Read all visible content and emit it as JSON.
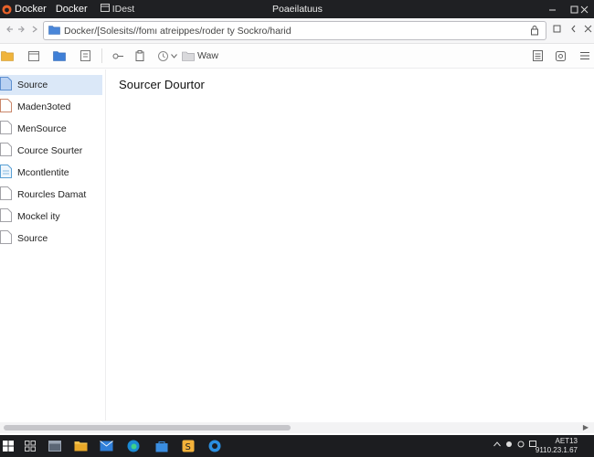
{
  "titlebar": {
    "tabs": [
      "Docker",
      "Docker"
    ],
    "subtitle": "IDest",
    "window_title": "Poaeilatuus"
  },
  "address": {
    "path": "Docker/[Solesits//fomı atreippes/roder ty Sockro/harid"
  },
  "toolbar": {
    "location_label": "Waw"
  },
  "sidebar": {
    "items": [
      {
        "label": "Source",
        "selected": true,
        "icon": "doc-blue-icon"
      },
      {
        "label": "Maden3oted",
        "selected": false,
        "icon": "doc-orange-icon"
      },
      {
        "label": "MenSource",
        "selected": false,
        "icon": "doc-icon"
      },
      {
        "label": "Cource Sourter",
        "selected": false,
        "icon": "doc-icon"
      },
      {
        "label": "Mcontlentite",
        "selected": false,
        "icon": "doc-lined-icon"
      },
      {
        "label": "Rourcles Damat",
        "selected": false,
        "icon": "doc-icon"
      },
      {
        "label": "Mockel ity",
        "selected": false,
        "icon": "doc-icon"
      },
      {
        "label": "Source",
        "selected": false,
        "icon": "doc-icon"
      }
    ]
  },
  "main": {
    "title": "Sourcer Dourtor"
  },
  "taskbar": {
    "clock_line1": "AET13",
    "clock_line2": "9110.23.1.67"
  },
  "colors": {
    "titlebar_bg": "#1f2023",
    "taskbar_bg": "#1c1d20",
    "selected_bg": "#dbe8f8",
    "accent": "#e8622a"
  }
}
